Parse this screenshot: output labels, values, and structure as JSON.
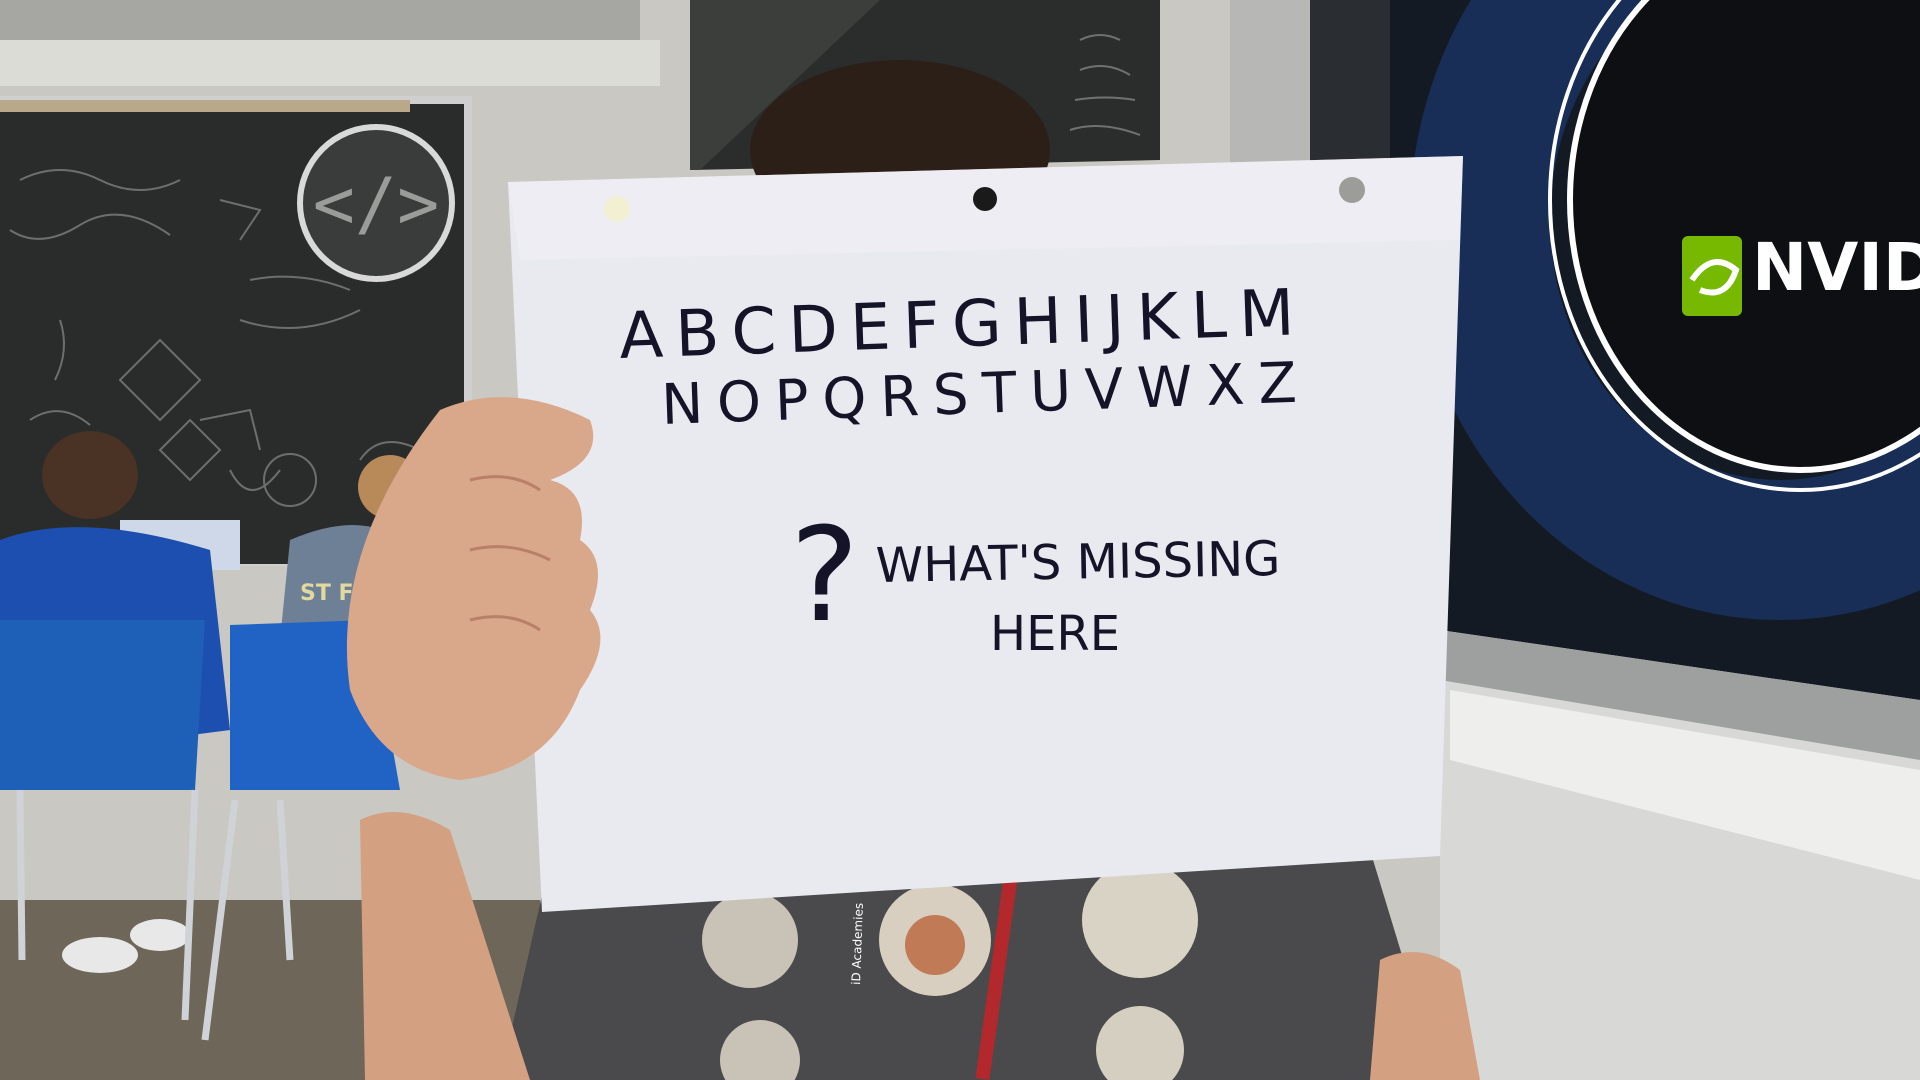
{
  "sign": {
    "line1": "A B C D E F G H I J K L M",
    "line2": "N O P Q R S T U V W X  Z",
    "question_line1": "WHAT'S MISSING",
    "question_line2": "HERE",
    "question_mark": "?"
  },
  "banner": {
    "brand": "NVIDIA"
  },
  "logo_board": {
    "symbol": "</>"
  },
  "shirts": {
    "back_shirt_text": "ST FR WE IN"
  },
  "lanyard": {
    "text": "iD Academies"
  },
  "colors": {
    "paper": "#e9e9f0",
    "ink": "#141428",
    "chalkboard": "#2b2d2c",
    "nvidia_green": "#76b900",
    "chair_blue": "#1e5fb8",
    "shirt_blue": "#1d4fb0",
    "banner_dark": "#101820"
  }
}
